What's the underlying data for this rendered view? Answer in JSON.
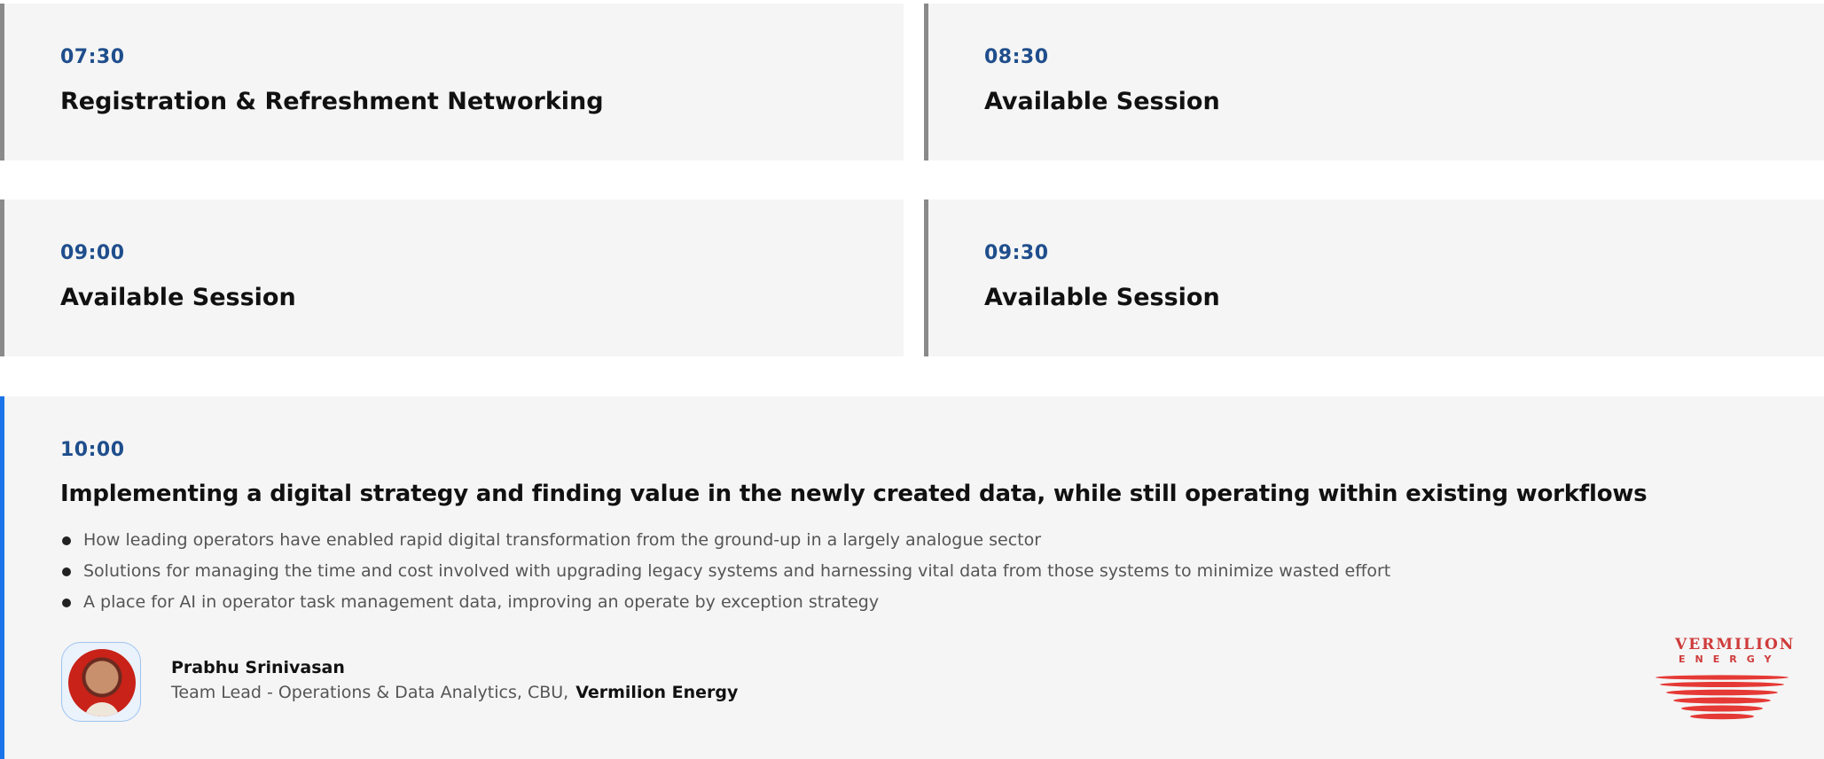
{
  "sessions": [
    {
      "time": "07:30",
      "title": "Registration & Refreshment Networking"
    },
    {
      "time": "08:30",
      "title": "Available Session"
    },
    {
      "time": "09:00",
      "title": "Available Session"
    },
    {
      "time": "09:30",
      "title": "Available Session"
    }
  ],
  "featured": {
    "time": "10:00",
    "title": "Implementing a digital strategy and finding value in the newly created data, while still operating within existing workflows",
    "bullets": [
      "How leading operators have enabled rapid digital transformation from the ground-up in a largely analogue sector",
      "Solutions for managing the time and cost involved with upgrading legacy systems and harnessing vital data from those systems to minimize wasted effort",
      "A place for AI in operator task management data, improving an operate by exception strategy"
    ],
    "speaker": {
      "name": "Prabhu Srinivasan",
      "role": "Team Lead - Operations & Data Analytics, CBU,",
      "company": "Vermilion Energy"
    },
    "logo": {
      "line1": "VERMILION",
      "line2": "ENERGY",
      "color": "#e53935"
    }
  },
  "colors": {
    "time": "#1f4e8c",
    "accent": "#1a73e8",
    "card_border": "#8a8a8a",
    "card_bg": "#f5f5f5"
  }
}
